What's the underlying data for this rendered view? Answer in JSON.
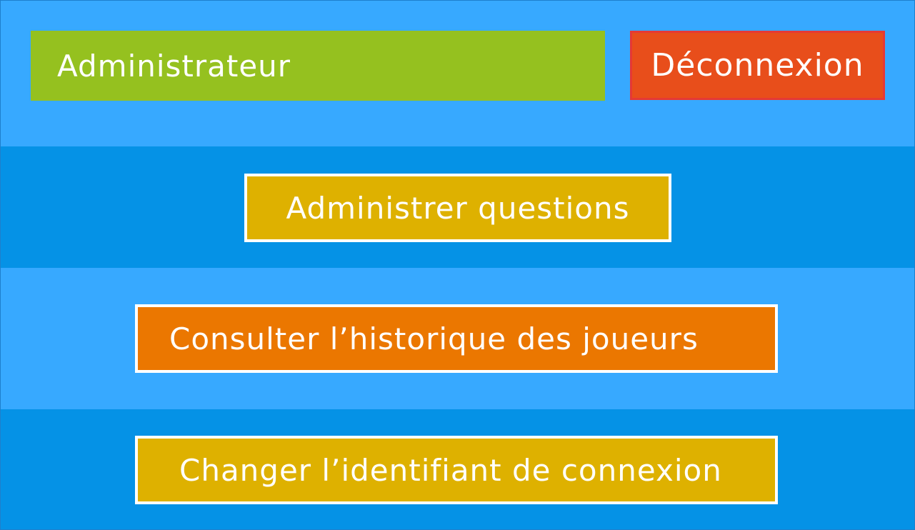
{
  "header": {
    "title": "Administrateur",
    "logout_label": "Déconnexion"
  },
  "menu": {
    "items": [
      {
        "label": "Administrer questions"
      },
      {
        "label": "Consulter l’historique des joueurs"
      },
      {
        "label": "Changer l’identifiant de connexion"
      }
    ]
  },
  "colors": {
    "background_light": "#37A9FF",
    "background_dark": "#0592E6",
    "title_green": "#95C11F",
    "logout_red": "#E84E1B",
    "button_yellow": "#DEB100",
    "button_orange": "#EB7700"
  }
}
